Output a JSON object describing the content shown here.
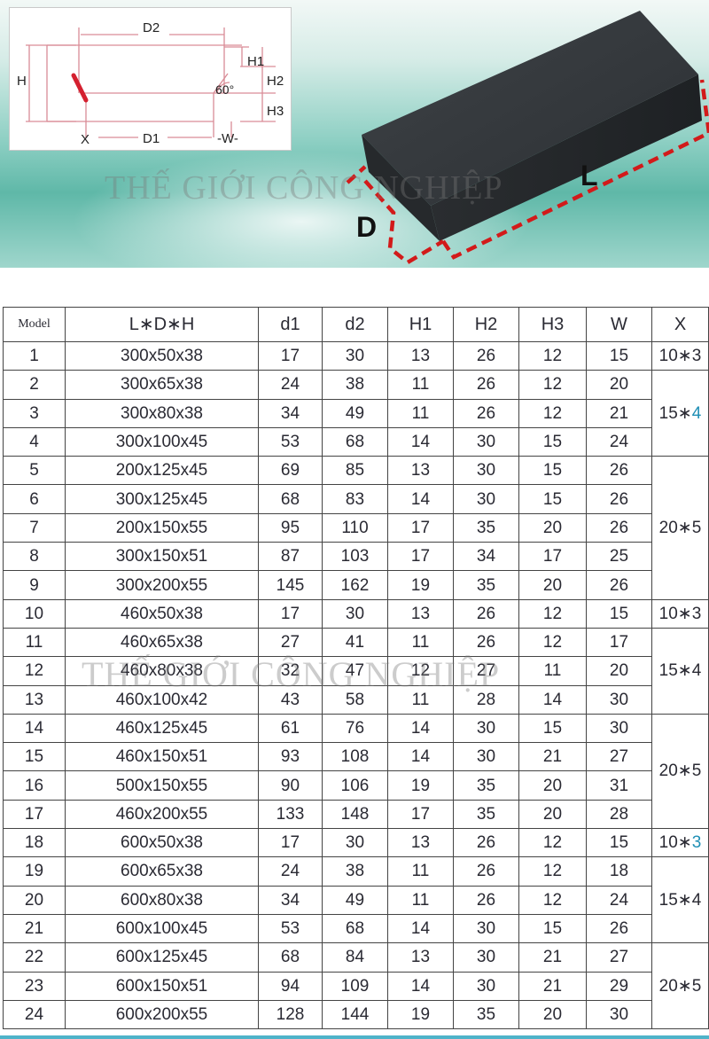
{
  "diagram": {
    "labels": {
      "D2": "D2",
      "H1": "H1",
      "H": "H",
      "H2": "H2",
      "angle": "60°",
      "H3": "H3",
      "X": "X",
      "D1": "D1",
      "W": "-W-"
    }
  },
  "photo": {
    "L_label": "L",
    "D_label": "D"
  },
  "watermark": "THẾ GIỚI CÔNG NGHIỆP",
  "colors": {
    "accent": "#1f8fb5",
    "dashed": "#cc1f1f",
    "table_border": "#444444"
  },
  "table": {
    "headers": [
      "Model",
      "L∗D∗H",
      "d1",
      "d2",
      "H1",
      "H2",
      "H3",
      "W",
      "X"
    ],
    "rows": [
      [
        "1",
        "300x50x38",
        "17",
        "30",
        "13",
        "26",
        "12",
        "15"
      ],
      [
        "2",
        "300x65x38",
        "24",
        "38",
        "11",
        "26",
        "12",
        "20"
      ],
      [
        "3",
        "300x80x38",
        "34",
        "49",
        "11",
        "26",
        "12",
        "21"
      ],
      [
        "4",
        "300x100x45",
        "53",
        "68",
        "14",
        "30",
        "15",
        "24"
      ],
      [
        "5",
        "200x125x45",
        "69",
        "85",
        "13",
        "30",
        "15",
        "26"
      ],
      [
        "6",
        "300x125x45",
        "68",
        "83",
        "14",
        "30",
        "15",
        "26"
      ],
      [
        "7",
        "200x150x55",
        "95",
        "110",
        "17",
        "35",
        "20",
        "26"
      ],
      [
        "8",
        "300x150x51",
        "87",
        "103",
        "17",
        "34",
        "17",
        "25"
      ],
      [
        "9",
        "300x200x55",
        "145",
        "162",
        "19",
        "35",
        "20",
        "26"
      ],
      [
        "10",
        "460x50x38",
        "17",
        "30",
        "13",
        "26",
        "12",
        "15"
      ],
      [
        "11",
        "460x65x38",
        "27",
        "41",
        "11",
        "26",
        "12",
        "17"
      ],
      [
        "12",
        "460x80x38",
        "32",
        "47",
        "12",
        "27",
        "11",
        "20"
      ],
      [
        "13",
        "460x100x42",
        "43",
        "58",
        "11",
        "28",
        "14",
        "30"
      ],
      [
        "14",
        "460x125x45",
        "61",
        "76",
        "14",
        "30",
        "15",
        "30"
      ],
      [
        "15",
        "460x150x51",
        "93",
        "108",
        "14",
        "30",
        "21",
        "27"
      ],
      [
        "16",
        "500x150x55",
        "90",
        "106",
        "19",
        "35",
        "20",
        "31"
      ],
      [
        "17",
        "460x200x55",
        "133",
        "148",
        "17",
        "35",
        "20",
        "28"
      ],
      [
        "18",
        "600x50x38",
        "17",
        "30",
        "13",
        "26",
        "12",
        "15"
      ],
      [
        "19",
        "600x65x38",
        "24",
        "38",
        "11",
        "26",
        "12",
        "18"
      ],
      [
        "20",
        "600x80x38",
        "34",
        "49",
        "11",
        "26",
        "12",
        "24"
      ],
      [
        "21",
        "600x100x45",
        "53",
        "68",
        "14",
        "30",
        "15",
        "26"
      ],
      [
        "22",
        "600x125x45",
        "68",
        "84",
        "13",
        "30",
        "21",
        "27"
      ],
      [
        "23",
        "600x150x51",
        "94",
        "109",
        "14",
        "30",
        "21",
        "29"
      ],
      [
        "24",
        "600x200x55",
        "128",
        "144",
        "19",
        "35",
        "20",
        "30"
      ]
    ],
    "x_groups": [
      {
        "start": 0,
        "span": 1,
        "left": "10∗",
        "right": "3",
        "accent": false
      },
      {
        "start": 1,
        "span": 3,
        "left": "15∗",
        "right": "4",
        "accent": true
      },
      {
        "start": 4,
        "span": 5,
        "left": "20∗",
        "right": "5",
        "accent": false
      },
      {
        "start": 9,
        "span": 1,
        "left": "10∗",
        "right": "3",
        "accent": false
      },
      {
        "start": 10,
        "span": 3,
        "left": "15∗",
        "right": "4",
        "accent": false
      },
      {
        "start": 13,
        "span": 4,
        "left": "20∗",
        "right": "5",
        "accent": false
      },
      {
        "start": 17,
        "span": 1,
        "left": "10∗",
        "right": "3",
        "accent": true
      },
      {
        "start": 18,
        "span": 3,
        "left": "15∗",
        "right": "4",
        "accent": false
      },
      {
        "start": 21,
        "span": 3,
        "left": "20∗",
        "right": "5",
        "accent": false
      }
    ]
  }
}
